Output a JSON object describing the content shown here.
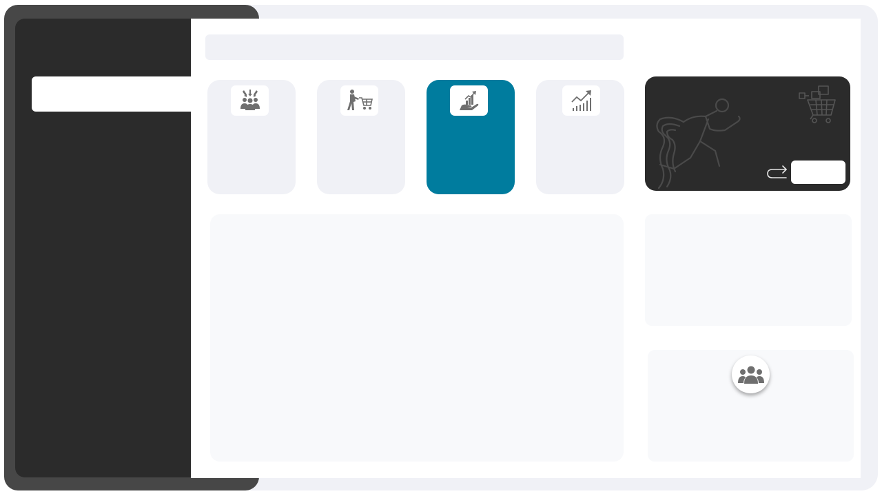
{
  "theme": {
    "accent": "#007c9e",
    "sidebar_dark": "#2b2b2b",
    "sidebar_frame": "#474747",
    "page_background": "#f0f1f6",
    "icon_gray": "#6f6f6f"
  },
  "sidebar": {
    "active_item": {
      "icon": "none",
      "label": ""
    }
  },
  "search": {
    "placeholder": "",
    "value": ""
  },
  "tiles": [
    {
      "icon": "team-focus-icon",
      "label": "",
      "active": false
    },
    {
      "icon": "shopper-cart-icon",
      "label": "",
      "active": false
    },
    {
      "icon": "growth-hand-icon",
      "label": "",
      "active": true
    },
    {
      "icon": "trend-chart-icon",
      "label": "",
      "active": false
    }
  ],
  "promo": {
    "illustration": [
      "runner-illustration",
      "shopping-cart-illustration"
    ],
    "action_icon": "redo-arrow-icon",
    "button_label": ""
  },
  "right_panel": {
    "avatar_icon": "user-group-icon"
  }
}
